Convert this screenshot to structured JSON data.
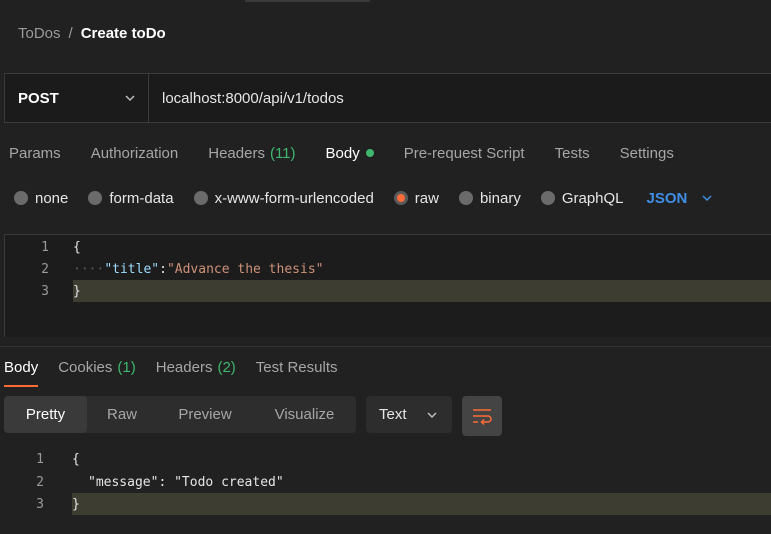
{
  "breadcrumb": {
    "parent": "ToDos",
    "separator": "/",
    "current": "Create toDo"
  },
  "request": {
    "method": "POST",
    "url": "localhost:8000/api/v1/todos"
  },
  "request_tabs": {
    "params": "Params",
    "authorization": "Authorization",
    "headers": "Headers",
    "headers_count": "(11)",
    "body": "Body",
    "prerequest": "Pre-request Script",
    "tests": "Tests",
    "settings": "Settings"
  },
  "body_types": {
    "none": "none",
    "form_data": "form-data",
    "urlencoded": "x-www-form-urlencoded",
    "raw": "raw",
    "binary": "binary",
    "graphql": "GraphQL",
    "format": "JSON",
    "selected": "raw"
  },
  "request_body": {
    "line_numbers": [
      "1",
      "2",
      "3"
    ],
    "open_brace": "{",
    "indent": "····",
    "key": "\"title\"",
    "colon": ":",
    "value": "\"Advance the thesis\"",
    "close_brace": "}"
  },
  "response_tabs": {
    "body": "Body",
    "cookies": "Cookies",
    "cookies_count": "(1)",
    "headers": "Headers",
    "headers_count": "(2)",
    "test_results": "Test Results"
  },
  "view_modes": {
    "pretty": "Pretty",
    "raw": "Raw",
    "preview": "Preview",
    "visualize": "Visualize",
    "format": "Text"
  },
  "response_body": {
    "line_numbers": [
      "1",
      "2",
      "3"
    ],
    "open_brace": "{",
    "key": "\"message\"",
    "colon": ": ",
    "value": "\"Todo created\"",
    "close_brace": "}"
  },
  "colors": {
    "accent": "#ff6c37",
    "green": "#3fb76e",
    "link_blue": "#3f8fe6",
    "background": "#212121"
  },
  "icons": {
    "method_dropdown": "chevron-down-icon",
    "format_dropdown": "chevron-down-icon",
    "wrap": "wrap-lines-icon"
  }
}
